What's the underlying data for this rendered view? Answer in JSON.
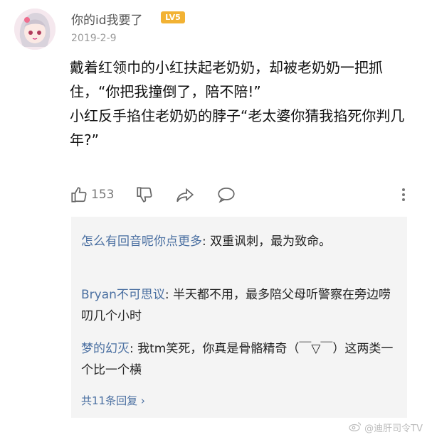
{
  "post": {
    "username": "你的id我要了",
    "level": "LV5",
    "date": "2019-2-9",
    "content": [
      "戴着红领巾的小红扶起老奶奶，却被老奶奶一把抓住，“你把我撞倒了，陪不陪!”",
      "小红反手掐住老奶奶的脖子“老太婆你猜我掐死你判几年?”"
    ],
    "likes": "153"
  },
  "icons": {
    "like": "thumbs-up-icon",
    "dislike": "thumbs-down-icon",
    "share": "share-icon",
    "comment": "comment-icon",
    "more": "more-vertical-icon"
  },
  "replies": [
    {
      "name": "怎么有回音呢你点更多",
      "text": ": 双重讽刺，最为致命。"
    },
    {
      "name": "Bryan不可思议",
      "text": ": 半天都不用，最多陪父母听警察在旁边唠叨几个小时"
    },
    {
      "name": "梦的幻灭",
      "text": ": 我tm笑死，你真是骨骼精奇（￣▽￣）这两类一个比一个横"
    }
  ],
  "more_replies": "共11条回复 ›",
  "watermark": "@迪肝司令TV"
}
